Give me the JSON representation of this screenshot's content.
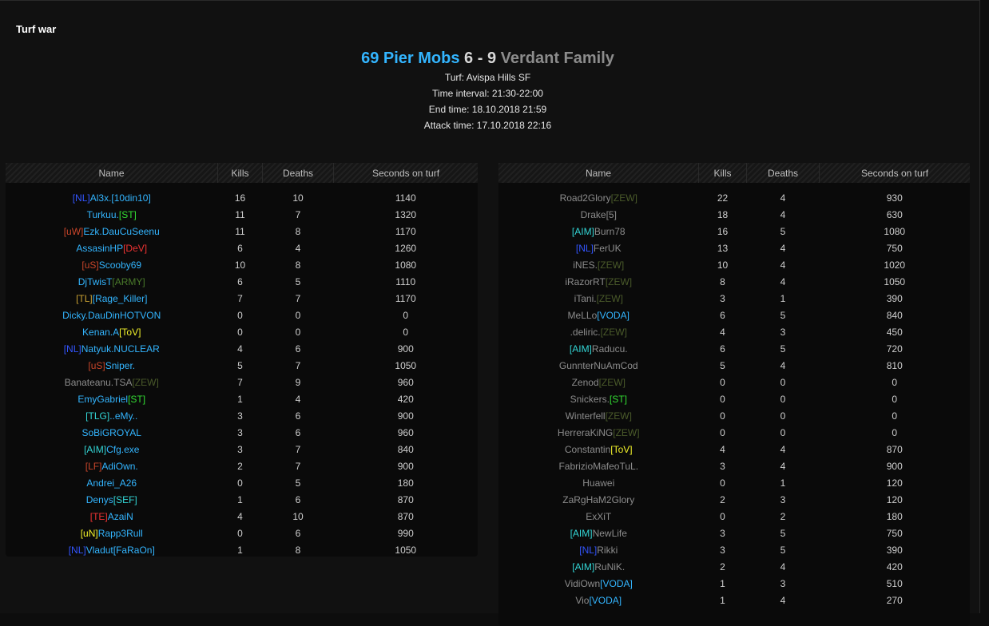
{
  "panel": {
    "title": "Turf war"
  },
  "match": {
    "team1_name": "69 Pier Mobs",
    "team1_score": "6",
    "separator": "-",
    "team2_score": "9",
    "team2_name": "Verdant Family",
    "turf": "Turf: Avispa Hills SF",
    "time_interval": "Time interval: 21:30-22:00",
    "end_time": "End time: 18.10.2018 21:59",
    "attack_time": "Attack time: 17.10.2018 22:16"
  },
  "colors": {
    "team1": "#33b5ff",
    "team2": "#8c8c8c",
    "score": "#d8d8d8"
  },
  "columns": [
    "Name",
    "Kills",
    "Deaths",
    "Seconds on turf"
  ],
  "left_rows": [
    {
      "parts": [
        {
          "t": "[NL]",
          "c": "#3355ff"
        },
        {
          "t": "Al3x.[10din10]",
          "c": "#33b5ff"
        }
      ],
      "kills": "16",
      "deaths": "10",
      "seconds": "1140"
    },
    {
      "parts": [
        {
          "t": "Turkuu.",
          "c": "#33b5ff"
        },
        {
          "t": "[ST]",
          "c": "#33dd33"
        }
      ],
      "kills": "11",
      "deaths": "7",
      "seconds": "1320"
    },
    {
      "parts": [
        {
          "t": "[uW]",
          "c": "#c8452a"
        },
        {
          "t": "Ezk.DauCuSeenu",
          "c": "#33b5ff"
        }
      ],
      "kills": "11",
      "deaths": "8",
      "seconds": "1170"
    },
    {
      "parts": [
        {
          "t": "AssasinHP",
          "c": "#33b5ff"
        },
        {
          "t": "[DeV]",
          "c": "#ee3333"
        }
      ],
      "kills": "6",
      "deaths": "4",
      "seconds": "1260"
    },
    {
      "parts": [
        {
          "t": "[uS]",
          "c": "#c8452a"
        },
        {
          "t": "Scooby69",
          "c": "#33b5ff"
        }
      ],
      "kills": "10",
      "deaths": "8",
      "seconds": "1080"
    },
    {
      "parts": [
        {
          "t": "DjTwisT",
          "c": "#33b5ff"
        },
        {
          "t": "[ARMY]",
          "c": "#4a7a2a"
        }
      ],
      "kills": "6",
      "deaths": "5",
      "seconds": "1110"
    },
    {
      "parts": [
        {
          "t": "[TL]",
          "c": "#c8a032"
        },
        {
          "t": "[Rage_Killer]",
          "c": "#33b5ff"
        }
      ],
      "kills": "7",
      "deaths": "7",
      "seconds": "1170"
    },
    {
      "parts": [
        {
          "t": "Dicky.DauDinHOTVON",
          "c": "#33b5ff"
        }
      ],
      "kills": "0",
      "deaths": "0",
      "seconds": "0"
    },
    {
      "parts": [
        {
          "t": "Kenan.A",
          "c": "#33b5ff"
        },
        {
          "t": "[ToV]",
          "c": "#f2f22a"
        }
      ],
      "kills": "0",
      "deaths": "0",
      "seconds": "0"
    },
    {
      "parts": [
        {
          "t": "[NL]",
          "c": "#3355ff"
        },
        {
          "t": "Natyuk.NUCLEAR",
          "c": "#33b5ff"
        }
      ],
      "kills": "4",
      "deaths": "6",
      "seconds": "900"
    },
    {
      "parts": [
        {
          "t": "[uS]",
          "c": "#c8452a"
        },
        {
          "t": "Sniper.",
          "c": "#33b5ff"
        }
      ],
      "kills": "5",
      "deaths": "7",
      "seconds": "1050"
    },
    {
      "parts": [
        {
          "t": "Banateanu.TSA",
          "c": "#8c8c8c"
        },
        {
          "t": "[ZEW]",
          "c": "#4a5a2a"
        }
      ],
      "kills": "7",
      "deaths": "9",
      "seconds": "960"
    },
    {
      "parts": [
        {
          "t": "EmyGabriel",
          "c": "#33b5ff"
        },
        {
          "t": "[ST]",
          "c": "#33dd33"
        }
      ],
      "kills": "1",
      "deaths": "4",
      "seconds": "420"
    },
    {
      "parts": [
        {
          "t": "[TLG]",
          "c": "#33d6d6"
        },
        {
          "t": "..eMy..",
          "c": "#33b5ff"
        }
      ],
      "kills": "3",
      "deaths": "6",
      "seconds": "900"
    },
    {
      "parts": [
        {
          "t": "SoBiGROYAL",
          "c": "#33b5ff"
        }
      ],
      "kills": "3",
      "deaths": "6",
      "seconds": "960"
    },
    {
      "parts": [
        {
          "t": "[AIM]",
          "c": "#33d6d6"
        },
        {
          "t": "Cfg.exe",
          "c": "#33b5ff"
        }
      ],
      "kills": "3",
      "deaths": "7",
      "seconds": "840"
    },
    {
      "parts": [
        {
          "t": "[LF]",
          "c": "#c8452a"
        },
        {
          "t": "AdiOwn.",
          "c": "#33b5ff"
        }
      ],
      "kills": "2",
      "deaths": "7",
      "seconds": "900"
    },
    {
      "parts": [
        {
          "t": "Andrei_A26",
          "c": "#33b5ff"
        }
      ],
      "kills": "0",
      "deaths": "5",
      "seconds": "180"
    },
    {
      "parts": [
        {
          "t": "Denys",
          "c": "#33b5ff"
        },
        {
          "t": "[SEF]",
          "c": "#33d6d6"
        }
      ],
      "kills": "1",
      "deaths": "6",
      "seconds": "870"
    },
    {
      "parts": [
        {
          "t": "[TE]",
          "c": "#ee3333"
        },
        {
          "t": "AzaiN",
          "c": "#33b5ff"
        }
      ],
      "kills": "4",
      "deaths": "10",
      "seconds": "870"
    },
    {
      "parts": [
        {
          "t": "[uN]",
          "c": "#f2f22a"
        },
        {
          "t": "Rapp3Rull",
          "c": "#33b5ff"
        }
      ],
      "kills": "0",
      "deaths": "6",
      "seconds": "990"
    },
    {
      "parts": [
        {
          "t": "[NL]",
          "c": "#3355ff"
        },
        {
          "t": "Vladut[FaRaOn]",
          "c": "#33b5ff"
        }
      ],
      "kills": "1",
      "deaths": "8",
      "seconds": "1050"
    }
  ],
  "right_rows": [
    {
      "parts": [
        {
          "t": "Road2Glory",
          "c": "#8c8c8c"
        },
        {
          "t": "[ZEW]",
          "c": "#4a5a2a"
        }
      ],
      "kills": "22",
      "deaths": "4",
      "seconds": "930"
    },
    {
      "parts": [
        {
          "t": "Drake[5]",
          "c": "#8c8c8c"
        }
      ],
      "kills": "18",
      "deaths": "4",
      "seconds": "630"
    },
    {
      "parts": [
        {
          "t": "[AIM]",
          "c": "#33d6d6"
        },
        {
          "t": "Burn78",
          "c": "#8c8c8c"
        }
      ],
      "kills": "16",
      "deaths": "5",
      "seconds": "1080"
    },
    {
      "parts": [
        {
          "t": "[NL]",
          "c": "#3355ff"
        },
        {
          "t": "FerUK",
          "c": "#8c8c8c"
        }
      ],
      "kills": "13",
      "deaths": "4",
      "seconds": "750"
    },
    {
      "parts": [
        {
          "t": "iNES.",
          "c": "#8c8c8c"
        },
        {
          "t": "[ZEW]",
          "c": "#4a5a2a"
        }
      ],
      "kills": "10",
      "deaths": "4",
      "seconds": "1020"
    },
    {
      "parts": [
        {
          "t": "iRazorRT",
          "c": "#8c8c8c"
        },
        {
          "t": "[ZEW]",
          "c": "#4a5a2a"
        }
      ],
      "kills": "8",
      "deaths": "4",
      "seconds": "1050"
    },
    {
      "parts": [
        {
          "t": "iTani.",
          "c": "#8c8c8c"
        },
        {
          "t": "[ZEW]",
          "c": "#4a5a2a"
        }
      ],
      "kills": "3",
      "deaths": "1",
      "seconds": "390"
    },
    {
      "parts": [
        {
          "t": "MeLLo",
          "c": "#8c8c8c"
        },
        {
          "t": "[VODA]",
          "c": "#33b5ff"
        }
      ],
      "kills": "6",
      "deaths": "5",
      "seconds": "840"
    },
    {
      "parts": [
        {
          "t": ".deliric.",
          "c": "#8c8c8c"
        },
        {
          "t": "[ZEW]",
          "c": "#4a5a2a"
        }
      ],
      "kills": "4",
      "deaths": "3",
      "seconds": "450"
    },
    {
      "parts": [
        {
          "t": "[AIM]",
          "c": "#33d6d6"
        },
        {
          "t": "Raducu.",
          "c": "#8c8c8c"
        }
      ],
      "kills": "6",
      "deaths": "5",
      "seconds": "720"
    },
    {
      "parts": [
        {
          "t": "GunnterNuAmCod",
          "c": "#8c8c8c"
        }
      ],
      "kills": "5",
      "deaths": "4",
      "seconds": "810"
    },
    {
      "parts": [
        {
          "t": "Zenod",
          "c": "#8c8c8c"
        },
        {
          "t": "[ZEW]",
          "c": "#4a5a2a"
        }
      ],
      "kills": "0",
      "deaths": "0",
      "seconds": "0"
    },
    {
      "parts": [
        {
          "t": "Snickers.",
          "c": "#8c8c8c"
        },
        {
          "t": "[ST]",
          "c": "#33dd33"
        }
      ],
      "kills": "0",
      "deaths": "0",
      "seconds": "0"
    },
    {
      "parts": [
        {
          "t": "Winterfell",
          "c": "#8c8c8c"
        },
        {
          "t": "[ZEW]",
          "c": "#4a5a2a"
        }
      ],
      "kills": "0",
      "deaths": "0",
      "seconds": "0"
    },
    {
      "parts": [
        {
          "t": "HerreraKiNG",
          "c": "#8c8c8c"
        },
        {
          "t": "[ZEW]",
          "c": "#4a5a2a"
        }
      ],
      "kills": "0",
      "deaths": "0",
      "seconds": "0"
    },
    {
      "parts": [
        {
          "t": "Constantin",
          "c": "#8c8c8c"
        },
        {
          "t": "[ToV]",
          "c": "#f2f22a"
        }
      ],
      "kills": "4",
      "deaths": "4",
      "seconds": "870"
    },
    {
      "parts": [
        {
          "t": "FabrizioMafeoTuL.",
          "c": "#8c8c8c"
        }
      ],
      "kills": "3",
      "deaths": "4",
      "seconds": "900"
    },
    {
      "parts": [
        {
          "t": "Huawei",
          "c": "#8c8c8c"
        }
      ],
      "kills": "0",
      "deaths": "1",
      "seconds": "120"
    },
    {
      "parts": [
        {
          "t": "ZaRgHaM2Glory",
          "c": "#8c8c8c"
        }
      ],
      "kills": "2",
      "deaths": "3",
      "seconds": "120"
    },
    {
      "parts": [
        {
          "t": "ExXiT",
          "c": "#8c8c8c"
        }
      ],
      "kills": "0",
      "deaths": "2",
      "seconds": "180"
    },
    {
      "parts": [
        {
          "t": "[AIM]",
          "c": "#33d6d6"
        },
        {
          "t": "NewLife",
          "c": "#8c8c8c"
        }
      ],
      "kills": "3",
      "deaths": "5",
      "seconds": "750"
    },
    {
      "parts": [
        {
          "t": "[NL]",
          "c": "#3355ff"
        },
        {
          "t": "Rikki",
          "c": "#8c8c8c"
        }
      ],
      "kills": "3",
      "deaths": "5",
      "seconds": "390"
    },
    {
      "parts": [
        {
          "t": "[AIM]",
          "c": "#33d6d6"
        },
        {
          "t": "RuNiK.",
          "c": "#8c8c8c"
        }
      ],
      "kills": "2",
      "deaths": "4",
      "seconds": "420"
    },
    {
      "parts": [
        {
          "t": "VidiOwn",
          "c": "#8c8c8c"
        },
        {
          "t": "[VODA]",
          "c": "#33b5ff"
        }
      ],
      "kills": "1",
      "deaths": "3",
      "seconds": "510"
    },
    {
      "parts": [
        {
          "t": "Vio",
          "c": "#8c8c8c"
        },
        {
          "t": "[VODA]",
          "c": "#33b5ff"
        }
      ],
      "kills": "1",
      "deaths": "4",
      "seconds": "270"
    }
  ]
}
